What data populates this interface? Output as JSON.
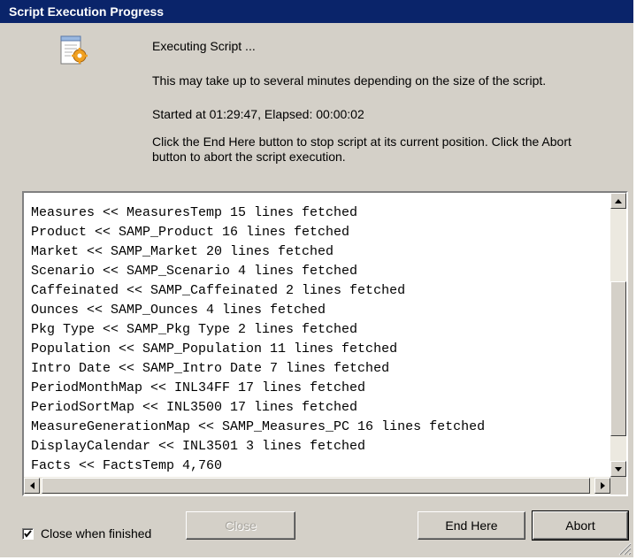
{
  "window": {
    "title": "Script Execution Progress"
  },
  "header": {
    "status": "Executing Script ...",
    "note": "This may take up to several minutes depending on the size of the script.",
    "timing": "Started at 01:29:47, Elapsed: 00:00:02",
    "instructions": "Click the End Here button to stop script at its current position. Click the Abort button to abort the script execution."
  },
  "log": {
    "lines": [
      "Measures << MeasuresTemp 15 lines fetched",
      "Product << SAMP_Product 16 lines fetched",
      "Market << SAMP_Market 20 lines fetched",
      "Scenario << SAMP_Scenario 4 lines fetched",
      "Caffeinated << SAMP_Caffeinated 2 lines fetched",
      "Ounces << SAMP_Ounces 4 lines fetched",
      "Pkg Type << SAMP_Pkg Type 2 lines fetched",
      "Population << SAMP_Population 11 lines fetched",
      "Intro Date << SAMP_Intro Date 7 lines fetched",
      "PeriodMonthMap << INL34FF 17 lines fetched",
      "PeriodSortMap << INL3500 17 lines fetched",
      "MeasureGenerationMap << SAMP_Measures_PC 16 lines fetched",
      "DisplayCalendar << INL3501 3 lines fetched",
      "Facts << FactsTemp 4,760"
    ]
  },
  "footer": {
    "close_when_finished_label": "Close when finished",
    "close_when_finished_checked": true,
    "close_label": "Close",
    "end_here_label": "End Here",
    "abort_label": "Abort"
  },
  "icons": {
    "script": "script-document-gear-icon",
    "scroll_up": "arrow-up-icon",
    "scroll_down": "arrow-down-icon",
    "scroll_left": "arrow-left-icon",
    "scroll_right": "arrow-right-icon",
    "resize": "resize-grip-icon"
  },
  "colors": {
    "titlebar": "#0a246a",
    "dialog_bg": "#d4d0c8",
    "log_bg": "#ffffff"
  }
}
